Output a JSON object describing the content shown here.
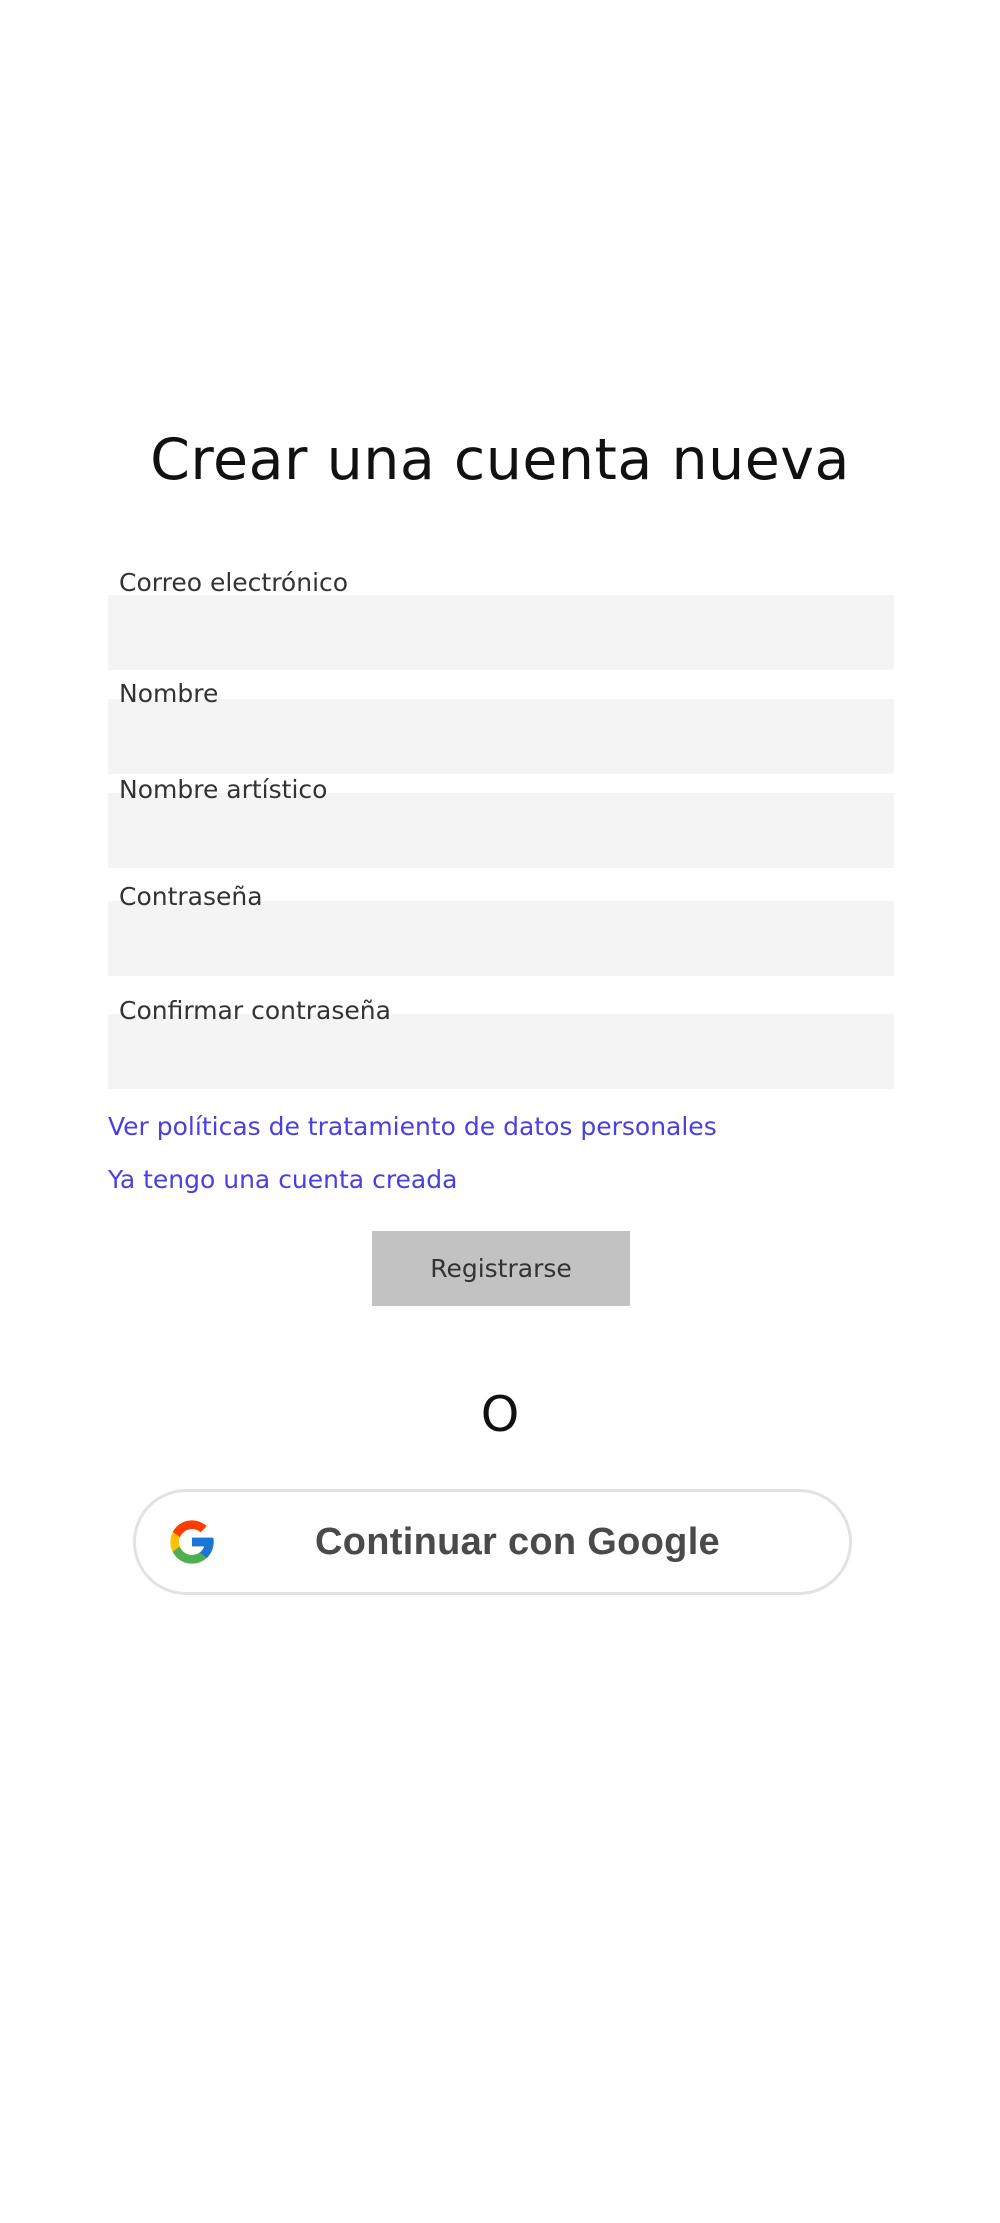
{
  "form": {
    "title": "Crear una cuenta nueva",
    "fields": [
      {
        "label": "Correo electrónico",
        "value": "",
        "placeholder": ""
      },
      {
        "label": "Nombre",
        "value": "",
        "placeholder": ""
      },
      {
        "label": "Nombre artístico",
        "value": "",
        "placeholder": ""
      },
      {
        "label": "Contraseña",
        "value": "",
        "placeholder": ""
      },
      {
        "label": "Confirmar contraseña",
        "value": "",
        "placeholder": ""
      }
    ],
    "privacy_link": "Ver políticas de tratamiento de datos personales",
    "login_link": "Ya tengo una cuenta creada",
    "register_label": "Registrarse",
    "separator": "O"
  },
  "google": {
    "label": "Continuar con Google",
    "icon": "google-logo-icon",
    "colors": {
      "blue": "#4285F4",
      "red": "#EA4335",
      "yellow": "#FBBC05",
      "green": "#34A853"
    }
  },
  "colors": {
    "link": "#4a3fe0",
    "input_background": "#f4f4f4",
    "register_button": "#c2c2c2"
  }
}
